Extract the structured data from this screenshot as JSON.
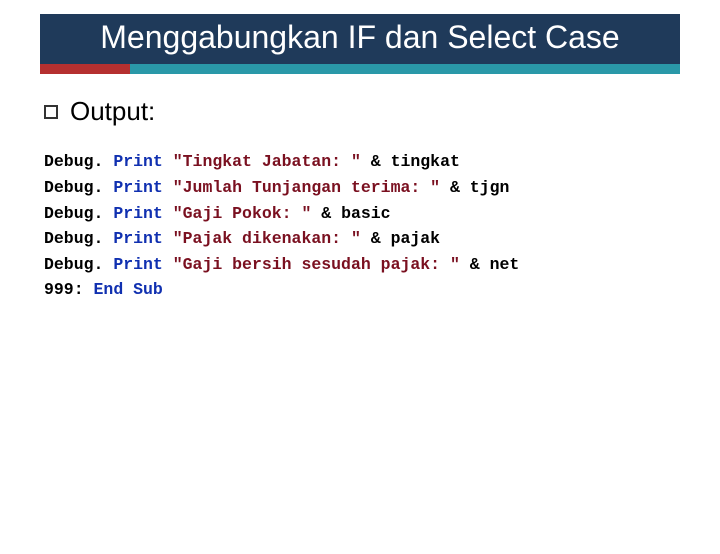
{
  "title": "Menggabungkan IF dan Select Case",
  "bullet_label": "Output:",
  "code": {
    "lines": [
      {
        "prefix": "Debug. ",
        "kw": "Print",
        "mid": " ",
        "str": "\"Tingkat Jabatan: \"",
        "tail": " & tingkat"
      },
      {
        "prefix": "Debug. ",
        "kw": "Print",
        "mid": " ",
        "str": "\"Jumlah Tunjangan terima: \"",
        "tail": " & tjgn"
      },
      {
        "prefix": "Debug. ",
        "kw": "Print",
        "mid": " ",
        "str": "\"Gaji Pokok: \"",
        "tail": " & basic"
      },
      {
        "prefix": "Debug. ",
        "kw": "Print",
        "mid": " ",
        "str": "\"Pajak dikenakan: \"",
        "tail": " & pajak"
      },
      {
        "prefix": "Debug. ",
        "kw": "Print",
        "mid": " ",
        "str": "\"Gaji bersih sesudah pajak: \"",
        "tail": " & net"
      }
    ],
    "last": {
      "prefix": "999: ",
      "kw": "End Sub"
    }
  }
}
